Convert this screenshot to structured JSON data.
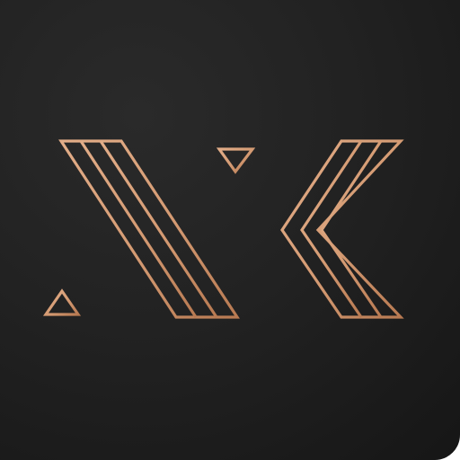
{
  "app_icon": {
    "icon_name": "geometric-lines-logo-icon",
    "background_color": "#1f1f1f",
    "accent_color": "#d9a07a",
    "accent_color_dark": "#b87a52"
  }
}
